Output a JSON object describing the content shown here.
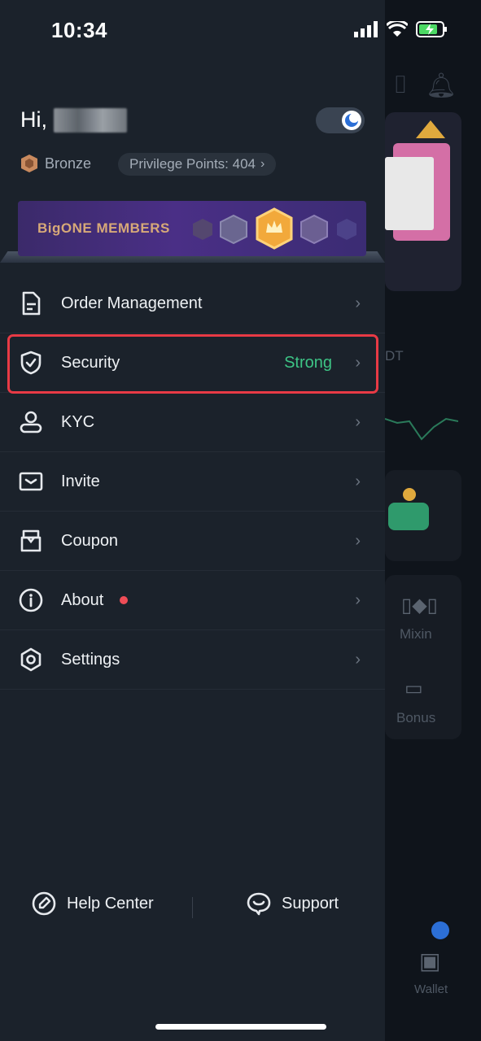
{
  "status": {
    "time": "10:34"
  },
  "greeting": {
    "prefix": "Hi,"
  },
  "member": {
    "tier": "Bronze",
    "points": "Privilege Points: 404",
    "banner": "BigONE MEMBERS"
  },
  "menu": [
    {
      "label": "Order Management",
      "icon": "document-icon"
    },
    {
      "label": "Security",
      "value": "Strong",
      "icon": "shield-check-icon"
    },
    {
      "label": "KYC",
      "icon": "user-icon"
    },
    {
      "label": "Invite",
      "icon": "envelope-icon"
    },
    {
      "label": "Coupon",
      "icon": "coupon-icon"
    },
    {
      "label": "About",
      "icon": "info-icon",
      "badge": true
    },
    {
      "label": "Settings",
      "icon": "hexagon-gear-icon"
    }
  ],
  "footer": {
    "help": "Help Center",
    "support": "Support"
  },
  "background": {
    "mixin": "Mixin",
    "bonus": "Bonus",
    "wallet": "Wallet",
    "dt": "DT"
  },
  "colors": {
    "accent_green": "#3dc485",
    "highlight_red": "#e83a45",
    "drawer_bg": "#1b222b"
  }
}
